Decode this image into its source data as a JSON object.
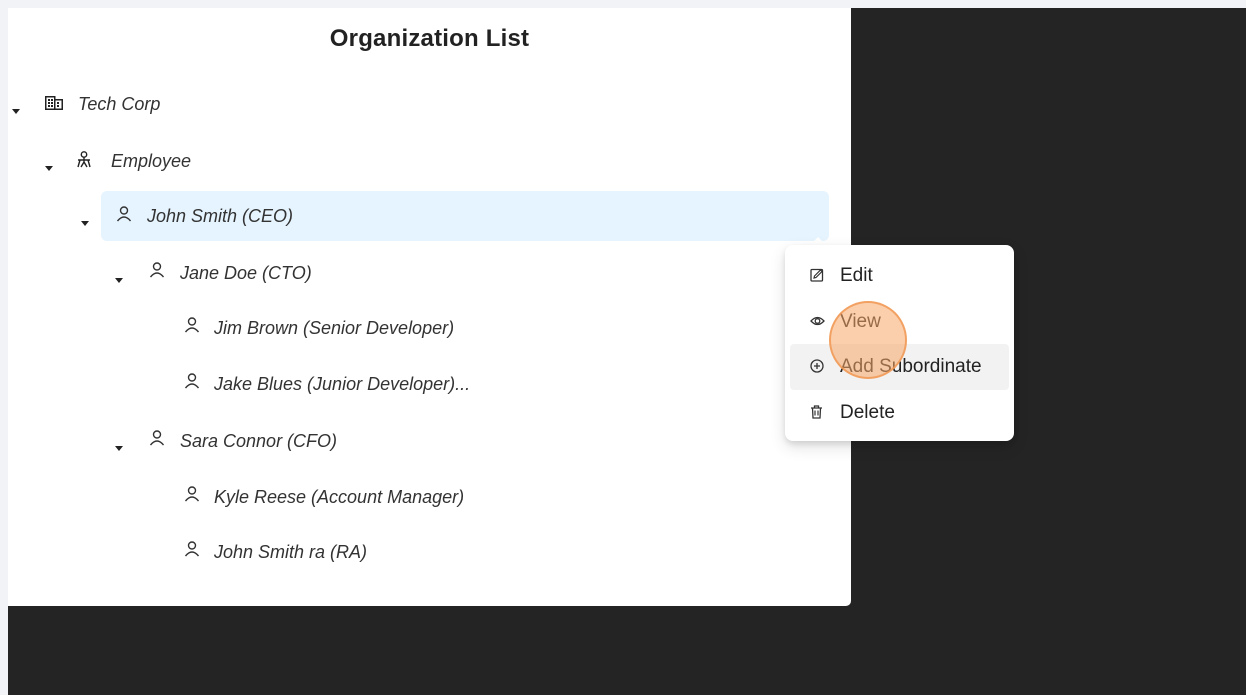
{
  "page": {
    "title": "Organization List"
  },
  "tree": {
    "root": {
      "label": "Tech Corp",
      "icon": "building-icon"
    },
    "group": {
      "label": "Employee",
      "icon": "org-icon"
    },
    "nodes": [
      {
        "label": "John Smith (CEO)",
        "icon": "user-icon",
        "selected": true
      },
      {
        "label": "Jane Doe (CTO)",
        "icon": "user-icon"
      },
      {
        "label": "Jim Brown (Senior Developer)",
        "icon": "user-icon"
      },
      {
        "label": "Jake Blues (Junior Developer)...",
        "icon": "user-icon"
      },
      {
        "label": "Sara Connor (CFO)",
        "icon": "user-icon"
      },
      {
        "label": "Kyle Reese (Account Manager)",
        "icon": "user-icon"
      },
      {
        "label": "John Smith ra (RA)",
        "icon": "user-icon"
      }
    ]
  },
  "context_menu": {
    "items": [
      {
        "label": "Edit",
        "icon": "edit-icon"
      },
      {
        "label": "View",
        "icon": "eye-icon"
      },
      {
        "label": "Add Subordinate",
        "icon": "plus-circle-icon",
        "hovered": true
      },
      {
        "label": "Delete",
        "icon": "trash-icon"
      }
    ]
  },
  "colors": {
    "selected_background": "#e6f4ff",
    "cursor_highlight": "#f7a768",
    "backdrop": "#242424"
  }
}
